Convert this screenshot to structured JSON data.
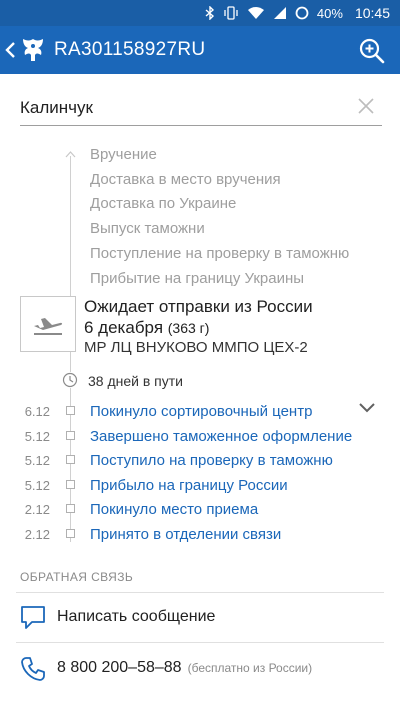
{
  "status_bar": {
    "battery": "40%",
    "time": "10:45",
    "icons": [
      "bluetooth-icon",
      "vibrate-icon",
      "wifi-icon",
      "signal-icon",
      "battery-icon"
    ]
  },
  "app_bar": {
    "title": "RA301158927RU",
    "icons": [
      "back-arrow-icon",
      "russian-post-logo",
      "add-search-icon"
    ]
  },
  "search": {
    "value": "Калинчук",
    "icon": "close-icon"
  },
  "timeline": {
    "future_steps": [
      "Вручение",
      "Доставка в место вручения",
      "Доставка по Украине",
      "Выпуск таможни",
      "Поступление на проверку в таможню",
      "Прибытие на границу Украины"
    ],
    "current": {
      "icon": "plane-icon",
      "title": "Ожидает отправки из России",
      "date": "6 декабря",
      "weight": "(363 г)",
      "location": "МР ЛЦ ВНУКОВО ММПО ЦЕХ-2"
    },
    "days_in_transit": "38 дней в пути",
    "events": [
      {
        "date": "6.12",
        "text": "Покинуло сортировочный центр"
      },
      {
        "date": "5.12",
        "text": "Завершено таможенное оформление"
      },
      {
        "date": "5.12",
        "text": "Поступило на проверку в таможню"
      },
      {
        "date": "5.12",
        "text": "Прибыло на границу России"
      },
      {
        "date": "2.12",
        "text": "Покинуло место приема"
      },
      {
        "date": "2.12",
        "text": "Принято в отделении связи"
      }
    ]
  },
  "feedback": {
    "section_label": "ОБРАТНАЯ СВЯЗЬ",
    "write_message": "Написать сообщение",
    "phone": "8 800 200–58–88",
    "phone_note": "(бесплатно из России)"
  },
  "colors": {
    "app_bar": "#1b67b9",
    "status_bar": "#1a5ea6",
    "link": "#1b67b9",
    "muted": "#9e9e9e"
  }
}
